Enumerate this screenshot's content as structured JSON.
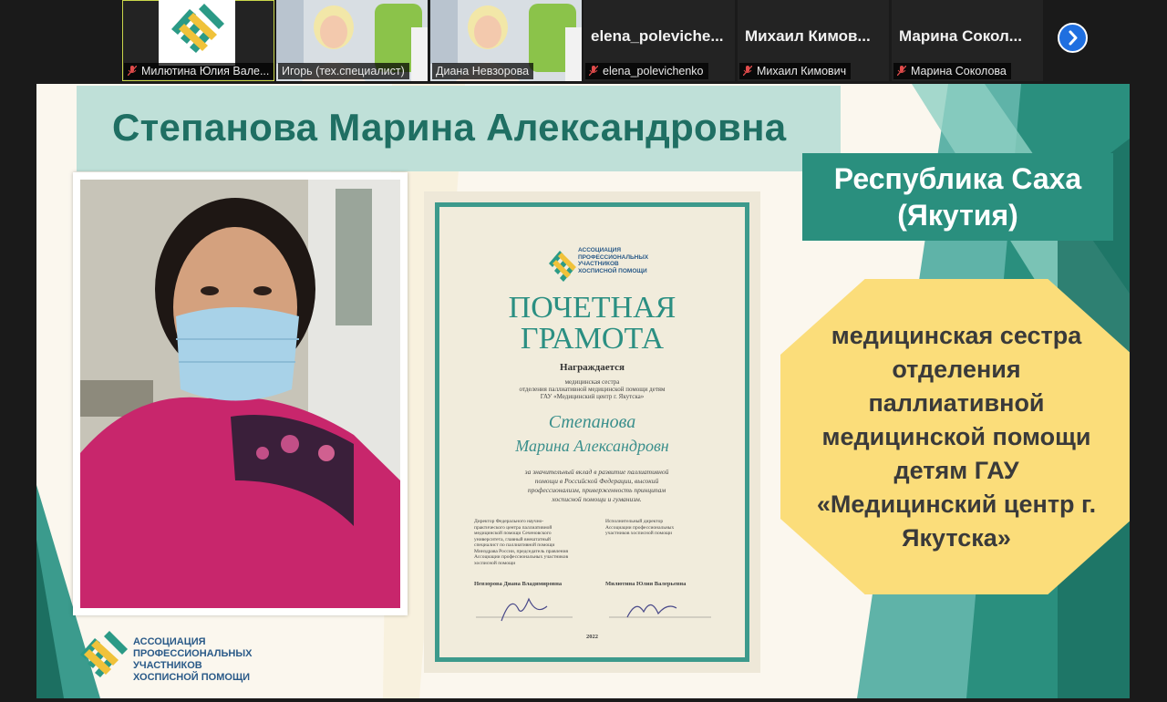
{
  "participants": [
    {
      "name": "Милютина Юлия Вале...",
      "muted": true,
      "type": "logo",
      "active": true
    },
    {
      "name": "Игорь (тех.специалист)",
      "muted": false,
      "type": "camera"
    },
    {
      "name": "Диана Невзорова",
      "muted": false,
      "type": "camera"
    },
    {
      "display": "elena_poleviche...",
      "name": "elena_polevichenko",
      "muted": true,
      "type": "name"
    },
    {
      "display": "Михаил Кимов...",
      "name": "Михаил Кимович",
      "muted": true,
      "type": "name"
    },
    {
      "display": "Марина Сокол...",
      "name": "Марина Соколова",
      "muted": true,
      "type": "name"
    }
  ],
  "slide": {
    "title": "Степанова Марина Александровна",
    "region_line1": "Республика Саха",
    "region_line2": "(Якутия)",
    "position_lines": [
      "медицинская сестра",
      "отделения",
      "паллиативной",
      "медицинской помощи",
      "детям ГАУ",
      "«Медицинский центр г.",
      "Якутска»"
    ],
    "association": {
      "lines": [
        "АССОЦИАЦИЯ",
        "ПРОФЕССИОНАЛЬНЫХ",
        "УЧАСТНИКОВ",
        "ХОСПИСНОЙ ПОМОЩИ"
      ]
    },
    "certificate": {
      "assoc_lines": [
        "АССОЦИАЦИЯ",
        "ПРОФЕССИОНАЛЬНЫХ",
        "УЧАСТНИКОВ",
        "ХОСПИСНОЙ ПОМОЩИ"
      ],
      "title_line1": "ПОЧЕТНАЯ",
      "title_line2": "ГРАМОТА",
      "awarded": "Награждается",
      "role_lines": [
        "медицинская сестра",
        "отделения паллиативной медицинской помощи детям",
        "ГАУ «Медицинский центр г. Якутска»"
      ],
      "surname": "Степанова",
      "given": "Марина Александровн",
      "reason_lines": [
        "за значительный вклад в развитие паллиативной",
        "помощи в Российской Федерации, высокий",
        "профессионализм, приверженность принципам",
        "хосписной помощи и гуманизм."
      ],
      "left_sig_lines": [
        "Директор Федерального научно-",
        "практического центра паллиативной",
        "медицинской помощи Сеченовского",
        "университета, главный внештатный",
        "специалист по паллиативной помощи",
        "Минздрава России, председатель правления",
        "Ассоциации профессиональных участников",
        "хосписной помощи"
      ],
      "right_sig_lines": [
        "Исполнительный директор",
        "Ассоциации профессиональных",
        "участников хосписной помощи"
      ],
      "left_signer": "Невзорова Диана Владимировна",
      "right_signer": "Милютина Юлия Валерьевна",
      "year": "2022"
    }
  },
  "colors": {
    "teal": "#2a8f7e",
    "title_teal": "#1f6f63",
    "mint": "#bfe0d8",
    "yellow": "#fbdd7a",
    "nav_blue": "#1f6fe0"
  }
}
